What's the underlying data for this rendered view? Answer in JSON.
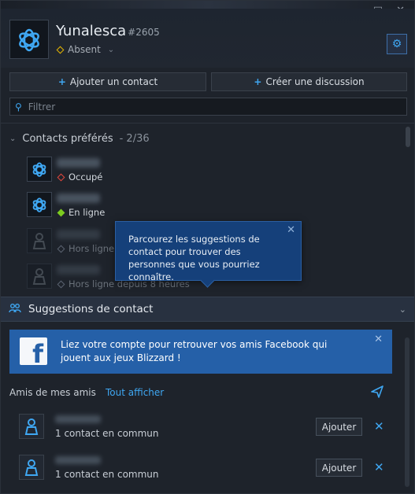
{
  "window": {
    "minimize": "—",
    "maximize": "□",
    "close": "✕"
  },
  "profile": {
    "name": "Yunalesca",
    "tag": "#2605",
    "status": "Absent"
  },
  "actions": {
    "add_contact": "Ajouter un contact",
    "create_discussion": "Créer une discussion"
  },
  "filter": {
    "placeholder": "Filtrer"
  },
  "favorites": {
    "title": "Contacts préférés",
    "count": "- 2/36",
    "contacts": [
      {
        "status": "Occupé"
      },
      {
        "status": "En ligne"
      },
      {
        "status": "Hors ligne"
      },
      {
        "status": "Hors ligne depuis 8 heures"
      }
    ]
  },
  "tooltip": {
    "text": "Parcourez les suggestions de contact pour trouver des personnes que vous pourriez connaître."
  },
  "suggestions": {
    "title": "Suggestions de contact",
    "facebook": {
      "text": "Liez votre compte pour retrouver vos amis Facebook qui jouent aux jeux Blizzard !"
    },
    "friends_of_friends": "Amis de mes amis",
    "show_all": "Tout afficher",
    "items": [
      {
        "common": "1 contact en commun",
        "add_label": "Ajouter"
      },
      {
        "common": "1 contact en commun",
        "add_label": "Ajouter"
      }
    ]
  },
  "colors": {
    "accent": "#3fa7f2",
    "facebook": "#2560a8",
    "busy": "#e3463c",
    "online": "#7ccc1f",
    "away": "#e6b600"
  }
}
